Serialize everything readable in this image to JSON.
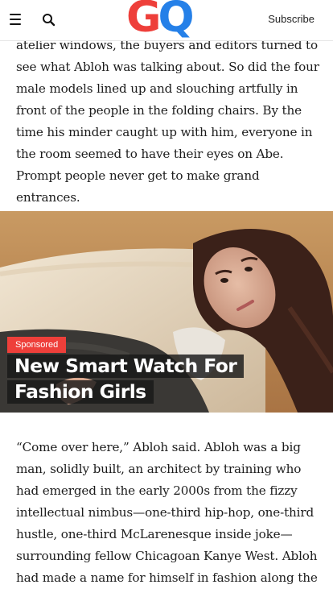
{
  "header": {
    "logo": {
      "g": "G",
      "q": "Q"
    },
    "subscribe_label": "Subscribe",
    "menu_icon": "hamburger-menu-icon",
    "search_icon": "search-icon"
  },
  "article": {
    "paragraph_top": "atelier windows, the buyers and editors turned to see what Abloh was talking about. So did the four male models lined up and slouching artfully in front of the people in the folding chairs. By the time his minder caught up with him, everyone in the room seemed to have their eyes on Abe. Prompt people never get to make grand entrances.",
    "paragraph_bottom": "“Come over here,” Abloh said. Abloh was a big man, solidly built, an architect by training who had emerged in the early 2000s from the fizzy intellectual nimbus—one-third hip-hop, one-third hustle, one-third McLarenesque inside joke—surrounding fellow Chicagoan Kanye West. Abloh had made a name for himself in fashion along the"
  },
  "promo": {
    "badge": "Sponsored",
    "title": "New Smart Watch For Fashion Girls"
  },
  "colors": {
    "logo_g": "#ee3f3a",
    "logo_q": "#2580e8",
    "sponsored_badge": "#ee3f3a",
    "title_bg": "#1a1a1a"
  }
}
